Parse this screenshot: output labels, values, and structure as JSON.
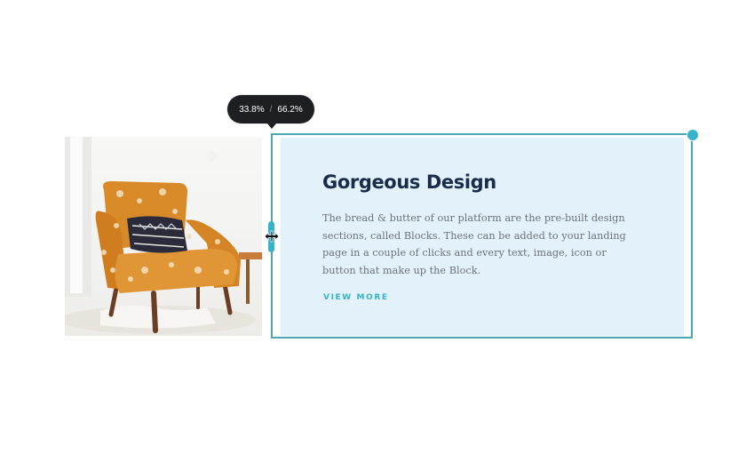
{
  "resize_tooltip": {
    "left_ratio": "33.8%",
    "separator": "/",
    "right_ratio": "66.2%"
  },
  "content_block": {
    "heading": "Gorgeous Design",
    "body": "The bread & butter of our platform are the pre-built design sections, called Blocks. These can be added to your landing page in a couple of clicks and every text, image, icon or button that make up the Block.",
    "link_label": "VIEW MORE"
  },
  "colors": {
    "accent": "#36b3cb",
    "selection_border": "#49a7b8",
    "card_background": "#e3f2fa",
    "heading": "#1b2b4b",
    "body_text": "#6b7178",
    "tooltip_background": "#1e1f22"
  },
  "icons": {
    "resize_cursor": "horizontal-resize-cursor-icon",
    "corner_handle": "selection-corner-handle-icon"
  }
}
